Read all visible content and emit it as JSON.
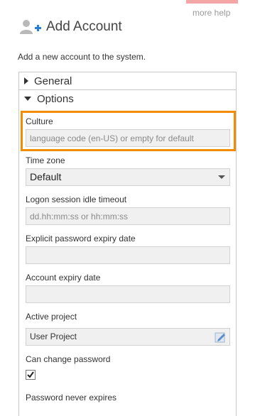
{
  "header": {
    "more_help": "more help",
    "title": "Add Account",
    "subtitle": "Add a new account to the system.",
    "title_icon": "add-user-icon"
  },
  "sections": {
    "general": {
      "label": "General",
      "expanded": false
    },
    "options": {
      "label": "Options",
      "expanded": true
    }
  },
  "fields": {
    "culture": {
      "label": "Culture",
      "value": "",
      "placeholder": "language code (en-US) or empty for default"
    },
    "time_zone": {
      "label": "Time zone",
      "value": "Default"
    },
    "idle_timeout": {
      "label": "Logon session idle timeout",
      "value": "",
      "placeholder": "dd.hh:mm:ss or hh:mm:ss"
    },
    "password_expiry": {
      "label": "Explicit password expiry date",
      "value": ""
    },
    "account_expiry": {
      "label": "Account expiry date",
      "value": ""
    },
    "active_project": {
      "label": "Active project",
      "value": "User Project"
    },
    "can_change_password": {
      "label": "Can change password",
      "checked": true
    },
    "password_never_expires": {
      "label": "Password never expires"
    }
  },
  "colors": {
    "highlight": "#f28c00",
    "icon_blue": "#2a7fd4",
    "help_bar": "#f4a5a5"
  }
}
